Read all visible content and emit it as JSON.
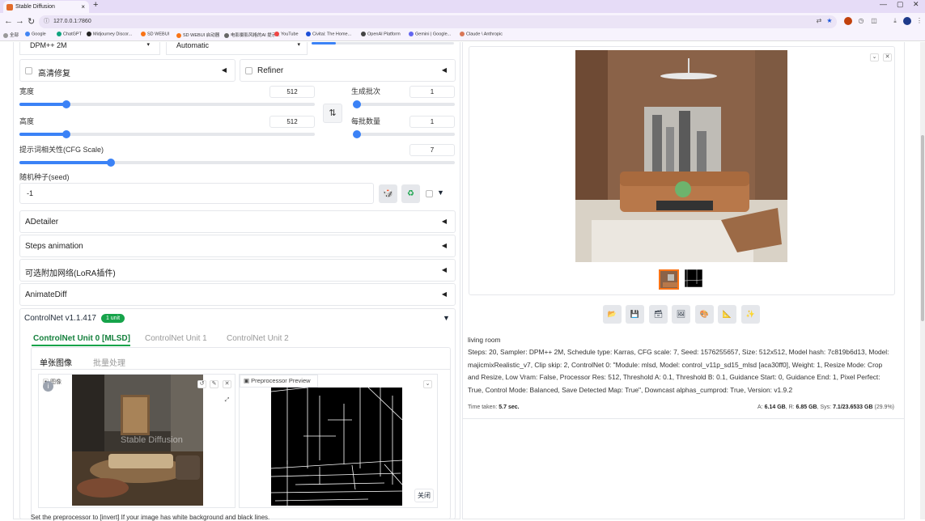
{
  "browser": {
    "tab_title": "Stable Diffusion",
    "new_tab": "+",
    "url": "127.0.0.1:7860",
    "bookmarks": [
      "全部",
      "Google",
      "ChatGPT",
      "Midjourney Discor...",
      "SD WEBUI",
      "SD WEBUI 启动器",
      "电影摄影风格的AI 提示...",
      "YouTube",
      "Civitai: The Home...",
      "OpenAI Platform",
      "Gemini | Google...",
      "Claude \\ Anthropic"
    ]
  },
  "left": {
    "sampler_value": "DPM++ 2M",
    "schedule_value": "Automatic",
    "hires_label": "高清修复",
    "refiner_label": "Refiner",
    "width_label": "宽度",
    "width_value": "512",
    "width_fraction": 0.16,
    "height_label": "高度",
    "height_value": "512",
    "height_fraction": 0.16,
    "batch_count_label": "生成批次",
    "batch_count_value": "1",
    "batch_size_label": "每批数量",
    "batch_size_value": "1",
    "cfg_label": "提示词相关性(CFG Scale)",
    "cfg_value": "7",
    "cfg_fraction": 0.21,
    "seed_label": "随机种子(seed)",
    "seed_value": "-1",
    "accordions": [
      "ADetailer",
      "Steps animation",
      "可选附加网络(LoRA插件)",
      "AnimateDiff"
    ],
    "controlnet_title": "ControlNet v1.1.417",
    "controlnet_badge": "1 unit",
    "cn_units": [
      "ControlNet Unit 0 [MLSD]",
      "ControlNet Unit 1",
      "ControlNet Unit 2"
    ],
    "cn_subtabs": [
      "单张图像",
      "批量处理"
    ],
    "image_label": "图像",
    "preview_label": "Preprocessor Preview",
    "close_label": "关闭",
    "watermark": "Stable Diffusion",
    "hint_text": "Set the preprocessor to [invert] If your image has white background and black lines."
  },
  "right": {
    "prompt": "living room",
    "params": "Steps: 20, Sampler: DPM++ 2M, Schedule type: Karras, CFG scale: 7, Seed: 1576255657, Size: 512x512, Model hash: 7c819b6d13, Model: majicmixRealistic_v7, Clip skip: 2, ControlNet 0: \"Module: mlsd, Model: control_v11p_sd15_mlsd [aca30ff0], Weight: 1, Resize Mode: Crop and Resize, Low Vram: False, Processor Res: 512, Threshold A: 0.1, Threshold B: 0.1, Guidance Start: 0, Guidance End: 1, Pixel Perfect: True, Control Mode: Balanced, Save Detected Map: True\", Downcast alphas_cumprod: True, Version: v1.9.2",
    "time_label": "Time taken:",
    "time_value": "5.7 sec.",
    "vram_a_label": "A:",
    "vram_a": "6.14 GB",
    "vram_r_label": "R:",
    "vram_r": "6.85 GB",
    "vram_sys_label": "Sys:",
    "vram_sys": "7.1/23.6533 GB",
    "vram_pct": "(29.9%)"
  }
}
